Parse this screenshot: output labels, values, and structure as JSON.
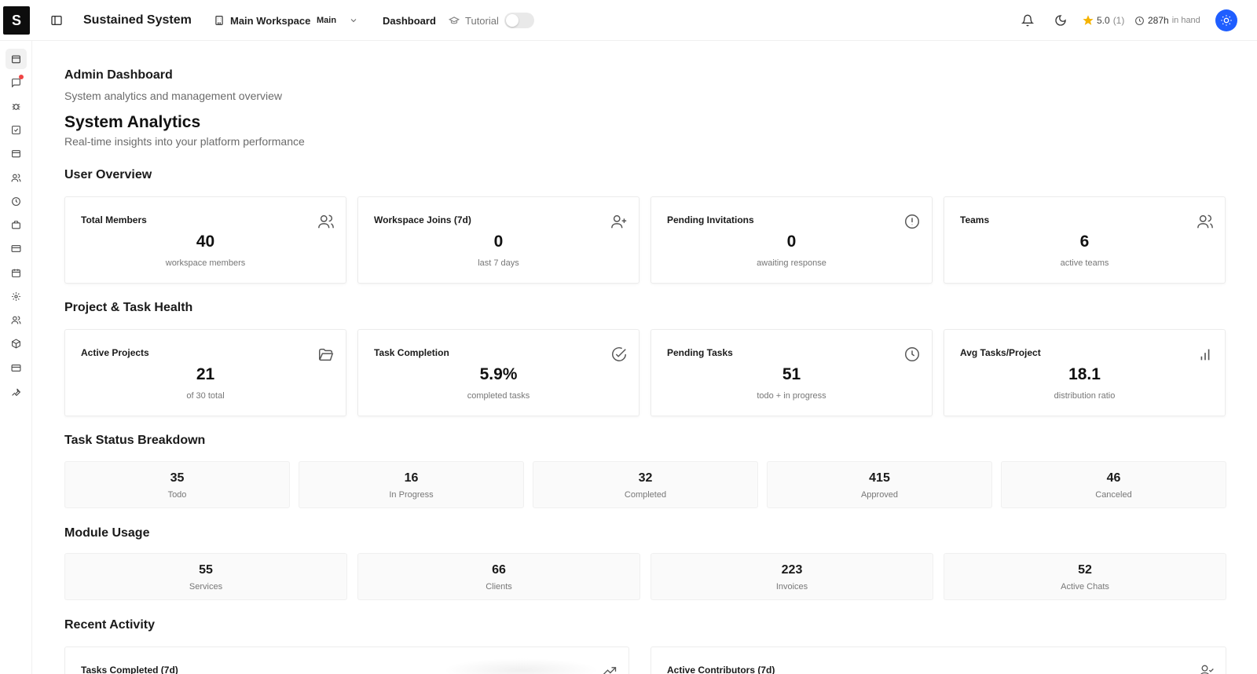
{
  "header": {
    "logo_letter": "S",
    "app_title": "Sustained System",
    "workspace": {
      "name": "Main Workspace",
      "badge": "Main"
    },
    "nav": {
      "dashboard": "Dashboard",
      "tutorial": "Tutorial",
      "tutorial_enabled": false
    },
    "rating": {
      "value": "5.0",
      "count": "(1)"
    },
    "hours": {
      "value": "287h",
      "suffix": "in hand"
    }
  },
  "sidebar": {
    "items": [
      {
        "icon": "dashboard-icon",
        "active": true
      },
      {
        "icon": "chat-icon",
        "notification": true
      },
      {
        "icon": "bug-icon"
      },
      {
        "icon": "tasks-icon"
      },
      {
        "icon": "inbox-icon"
      },
      {
        "icon": "users-icon"
      },
      {
        "icon": "clock-icon"
      },
      {
        "icon": "briefcase-icon"
      },
      {
        "icon": "card-icon"
      },
      {
        "icon": "calendar-icon"
      },
      {
        "icon": "settings-icon"
      },
      {
        "icon": "team-icon"
      },
      {
        "icon": "package-icon"
      },
      {
        "icon": "billing-icon"
      },
      {
        "icon": "wrench-icon"
      }
    ]
  },
  "page": {
    "title": "Admin Dashboard",
    "subtitle": "System analytics and management overview",
    "analytics_title": "System Analytics",
    "analytics_subtitle": "Real-time insights into your platform performance"
  },
  "sections": {
    "user_overview": "User Overview",
    "project_health": "Project & Task Health",
    "task_status": "Task Status Breakdown",
    "module_usage": "Module Usage",
    "recent_activity": "Recent Activity"
  },
  "user_overview": [
    {
      "title": "Total Members",
      "value": "40",
      "sub": "workspace members",
      "icon": "users-icon"
    },
    {
      "title": "Workspace Joins (7d)",
      "value": "0",
      "sub": "last 7 days",
      "icon": "user-plus-icon"
    },
    {
      "title": "Pending Invitations",
      "value": "0",
      "sub": "awaiting response",
      "icon": "alert-circle-icon"
    },
    {
      "title": "Teams",
      "value": "6",
      "sub": "active teams",
      "icon": "users-icon"
    }
  ],
  "project_health": [
    {
      "title": "Active Projects",
      "value": "21",
      "sub": "of 30 total",
      "icon": "folder-open-icon"
    },
    {
      "title": "Task Completion",
      "value": "5.9%",
      "sub": "completed tasks",
      "icon": "check-circle-icon"
    },
    {
      "title": "Pending Tasks",
      "value": "51",
      "sub": "todo + in progress",
      "icon": "clock-icon"
    },
    {
      "title": "Avg Tasks/Project",
      "value": "18.1",
      "sub": "distribution ratio",
      "icon": "bar-chart-icon"
    }
  ],
  "task_status": [
    {
      "value": "35",
      "label": "Todo"
    },
    {
      "value": "16",
      "label": "In Progress"
    },
    {
      "value": "32",
      "label": "Completed"
    },
    {
      "value": "415",
      "label": "Approved"
    },
    {
      "value": "46",
      "label": "Canceled"
    }
  ],
  "module_usage": [
    {
      "value": "55",
      "label": "Services"
    },
    {
      "value": "66",
      "label": "Clients"
    },
    {
      "value": "223",
      "label": "Invoices"
    },
    {
      "value": "52",
      "label": "Active Chats"
    }
  ],
  "recent_activity": [
    {
      "title": "Tasks Completed (7d)",
      "icon": "trending-up-icon"
    },
    {
      "title": "Active Contributors (7d)",
      "icon": "user-check-icon"
    }
  ]
}
